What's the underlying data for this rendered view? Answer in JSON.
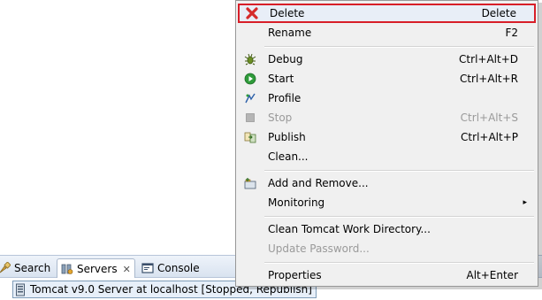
{
  "menu": {
    "items": [
      {
        "label": "Delete",
        "shortcut": "Delete",
        "icon": "delete-icon",
        "enabled": true,
        "highlighted": true
      },
      {
        "label": "Rename",
        "shortcut": "F2",
        "icon": "",
        "enabled": true
      },
      {
        "label": "Debug",
        "shortcut": "Ctrl+Alt+D",
        "icon": "debug-icon",
        "enabled": true
      },
      {
        "label": "Start",
        "shortcut": "Ctrl+Alt+R",
        "icon": "start-icon",
        "enabled": true
      },
      {
        "label": "Profile",
        "shortcut": "",
        "icon": "profile-icon",
        "enabled": true
      },
      {
        "label": "Stop",
        "shortcut": "Ctrl+Alt+S",
        "icon": "stop-icon",
        "enabled": false
      },
      {
        "label": "Publish",
        "shortcut": "Ctrl+Alt+P",
        "icon": "publish-icon",
        "enabled": true
      },
      {
        "label": "Clean...",
        "shortcut": "",
        "icon": "",
        "enabled": true
      },
      {
        "label": "Add and Remove...",
        "shortcut": "",
        "icon": "add-remove-icon",
        "enabled": true
      },
      {
        "label": "Monitoring",
        "shortcut": "",
        "icon": "",
        "enabled": true,
        "submenu": true
      },
      {
        "label": "Clean Tomcat Work Directory...",
        "shortcut": "",
        "icon": "",
        "enabled": true
      },
      {
        "label": "Update Password...",
        "shortcut": "",
        "icon": "",
        "enabled": false
      },
      {
        "label": "Properties",
        "shortcut": "Alt+Enter",
        "icon": "",
        "enabled": true
      }
    ],
    "submenu_arrow": "▸"
  },
  "tabs": [
    {
      "label": "Search",
      "icon": "search-icon"
    },
    {
      "label": "Servers",
      "icon": "servers-icon",
      "active": true,
      "close": "✕"
    },
    {
      "label": "Console",
      "icon": "console-icon"
    }
  ],
  "servers_view": {
    "row_label": "Tomcat v9.0 Server at localhost  [Stopped, Republish]",
    "icon": "server-icon"
  },
  "colors": {
    "highlight_border": "#d81e28",
    "delete_red": "#d52b2b",
    "start_green": "#2e9b3a",
    "menu_bg": "#f0f0f0"
  }
}
